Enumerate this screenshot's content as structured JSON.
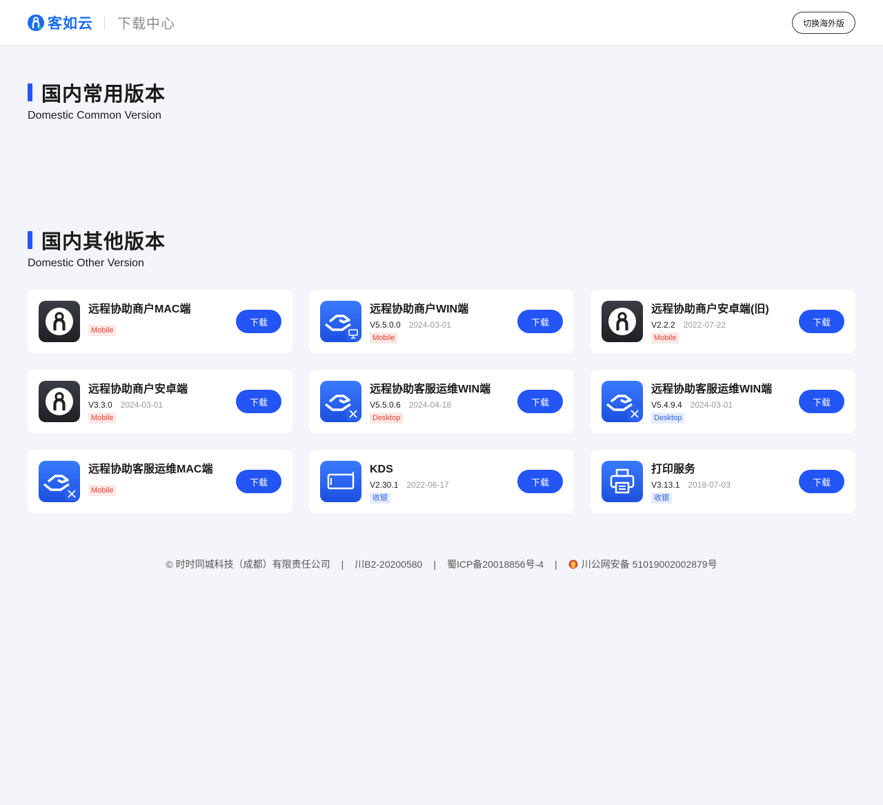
{
  "header": {
    "brand": "客如云",
    "title": "下载中心",
    "switch_label": "切换海外版"
  },
  "sections": [
    {
      "title": "国内常用版本",
      "subtitle": "Domestic Common Version"
    },
    {
      "title": "国内其他版本",
      "subtitle": "Domestic Other Version"
    }
  ],
  "apps": [
    {
      "name": "远程协助商户MAC端",
      "version": "",
      "date": "",
      "tag": "Mobile",
      "tag_style": "mobile",
      "icon": "keruyun-dark-icon",
      "button": "下载"
    },
    {
      "name": "远程协助商户WIN端",
      "version": "V5.5.0.0",
      "date": "2024-03-01",
      "tag": "Mobile",
      "tag_style": "mobile",
      "icon": "handshake-monitor-icon",
      "button": "下载"
    },
    {
      "name": "远程协助商户安卓端(旧)",
      "version": "V2.2.2",
      "date": "2022-07-22",
      "tag": "Mobile",
      "tag_style": "mobile",
      "icon": "keruyun-dark-icon",
      "button": "下载"
    },
    {
      "name": "远程协助商户安卓端",
      "version": "V3.3.0",
      "date": "2024-03-01",
      "tag": "Mobile",
      "tag_style": "mobile",
      "icon": "keruyun-dark-icon",
      "button": "下载"
    },
    {
      "name": "远程协助客服运维WIN端",
      "version": "V5.5.0.6",
      "date": "2024-04-18",
      "tag": "Desktop",
      "tag_style": "desktop-red",
      "icon": "handshake-tools-icon",
      "button": "下载"
    },
    {
      "name": "远程协助客服运维WIN端",
      "version": "V5.4.9.4",
      "date": "2024-03-01",
      "tag": "Desktop",
      "tag_style": "desktop-blue",
      "icon": "handshake-tools-icon",
      "button": "下载"
    },
    {
      "name": "远程协助客服运维MAC端",
      "version": "",
      "date": "",
      "tag": "Mobile",
      "tag_style": "mobile",
      "icon": "handshake-tools-icon",
      "button": "下载"
    },
    {
      "name": "KDS",
      "version": "V2.30.1",
      "date": "2022-06-17",
      "tag": "收银",
      "tag_style": "shouyin",
      "icon": "kds-screen-icon",
      "button": "下载"
    },
    {
      "name": "打印服务",
      "version": "V3.13.1",
      "date": "2018-07-03",
      "tag": "收银",
      "tag_style": "shouyin",
      "icon": "printer-icon",
      "button": "下载"
    }
  ],
  "footer": {
    "company": "© 时时同城科技（成都）有限责任公司",
    "license": "川B2-20200580",
    "icp": "蜀ICP备20018856号-4",
    "police": "川公网安备 51019002002879号",
    "separator": "|"
  },
  "colors": {
    "accent": "#2355f5",
    "brand": "#1b6cf2",
    "background": "#f4f5fa"
  }
}
